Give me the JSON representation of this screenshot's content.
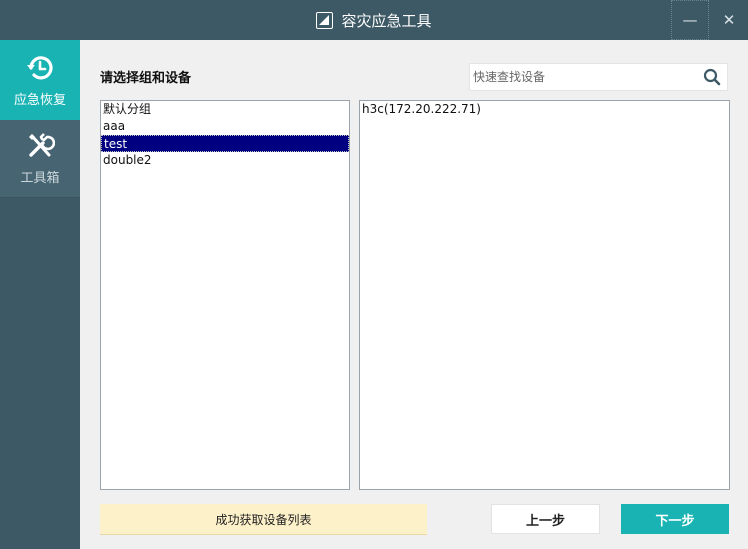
{
  "window": {
    "title": "容灾应急工具",
    "minimize_label": "—",
    "close_label": "✕"
  },
  "sidebar": {
    "items": [
      {
        "label": "应急恢复",
        "icon": "restore-clock-icon",
        "active": true
      },
      {
        "label": "工具箱",
        "icon": "tools-icon",
        "active": false
      }
    ]
  },
  "main": {
    "section_title": "请选择组和设备",
    "search": {
      "placeholder": "快速查找设备",
      "value": ""
    },
    "groups": [
      {
        "label": "默认分组",
        "selected": false
      },
      {
        "label": "aaa",
        "selected": false
      },
      {
        "label": "test",
        "selected": true
      },
      {
        "label": "double2",
        "selected": false
      }
    ],
    "devices": [
      {
        "label": "h3c(172.20.222.71)"
      }
    ],
    "status_text": "成功获取设备列表",
    "prev_button": "上一步",
    "next_button": "下一步"
  },
  "colors": {
    "accent": "#1ab3b3",
    "sidebar_bg": "#3d5966",
    "selection": "#000080",
    "status_bg": "#fdf1c9"
  }
}
